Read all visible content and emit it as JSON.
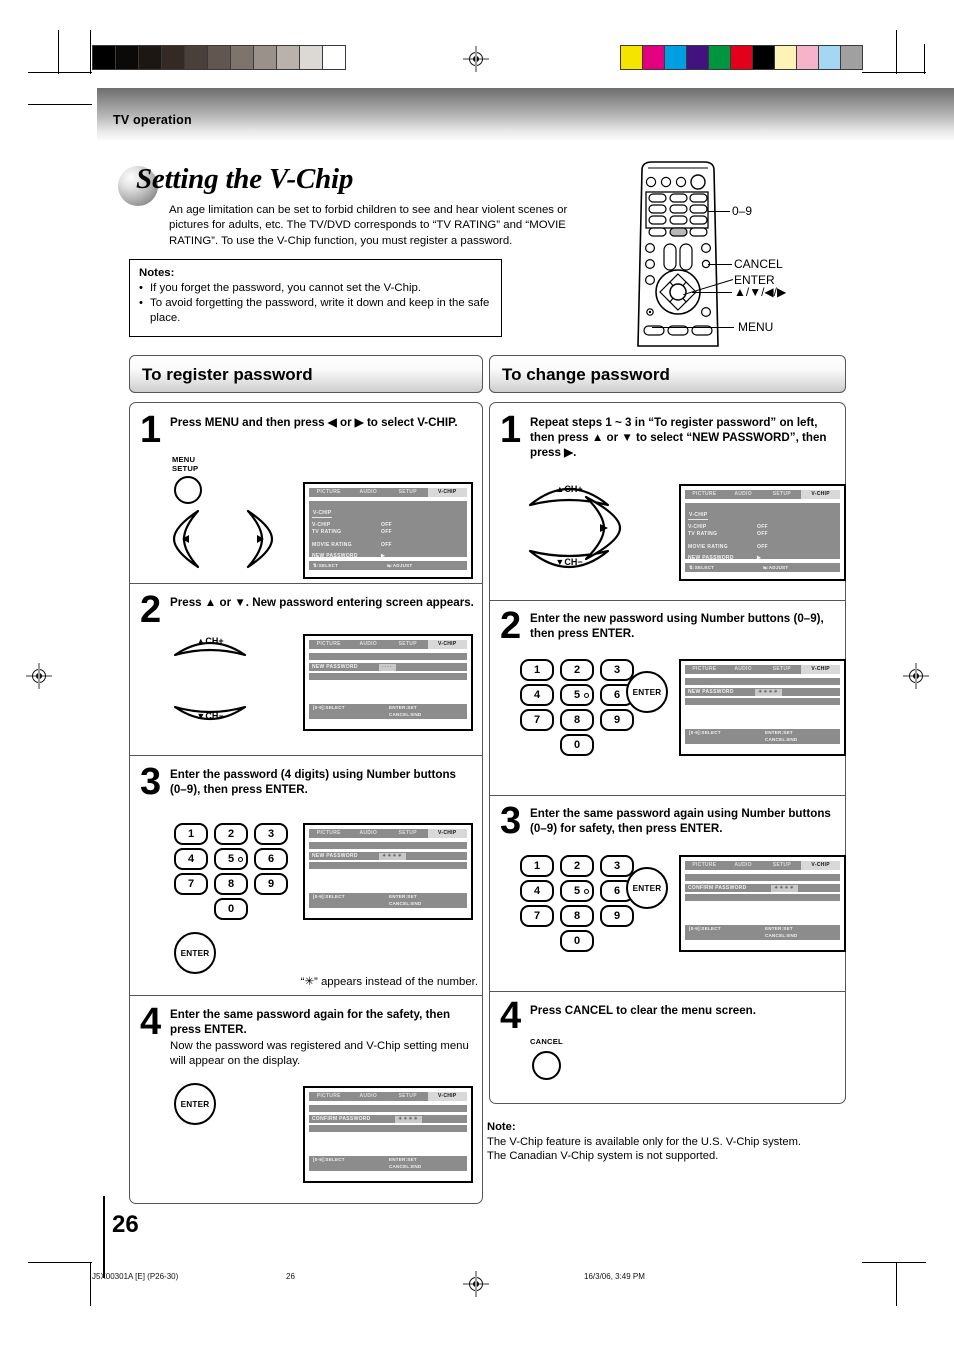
{
  "header": {
    "section": "TV operation"
  },
  "title": {
    "text": "Setting the V-Chip"
  },
  "intro": "An age limitation can be set to forbid children to see and hear violent scenes or pictures for adults, etc. The TV/DVD corresponds to “TV RATING” and “MOVIE RATING”. To use the V-Chip function, you must register a password.",
  "notes_box": {
    "heading": "Notes:",
    "items": [
      "If you forget the password, you cannot set the V-Chip.",
      "To avoid forgetting the password, write it down and keep in the safe place."
    ]
  },
  "remote_callouts": {
    "numbers": "0–9",
    "cancel": "CANCEL",
    "enter": "ENTER",
    "cursor": "▲/▼/◀/▶",
    "menu": "MENU"
  },
  "left_section": {
    "banner": "To register password",
    "steps": [
      {
        "num": "1",
        "text": "Press MENU and then press ◀ or ▶ to select V-CHIP.",
        "button_label": "MENU\nSETUP",
        "button_line1": "MENU",
        "button_line2": "SETUP"
      },
      {
        "num": "2",
        "text": "Press ▲ or ▼. New password entering screen appears.",
        "ch_up": "▲CH+",
        "ch_down": "▼CH−"
      },
      {
        "num": "3",
        "text": "Enter the password (4 digits) using Number buttons (0–9), then press ENTER.",
        "caption": "“✳” appears instead of the number.",
        "enter_label": "ENTER"
      },
      {
        "num": "4",
        "text_bold": "Enter the same password again for the safety, then press ENTER.",
        "text_plain": "Now the password was registered and V-Chip setting menu will appear on the display.",
        "enter_label": "ENTER"
      }
    ]
  },
  "right_section": {
    "banner": "To change password",
    "steps": [
      {
        "num": "1",
        "text": "Repeat steps 1 ~ 3 in “To register password” on left, then press ▲ or ▼ to select “NEW PASSWORD”, then press ▶.",
        "ch_up": "▲CH+",
        "ch_down": "▼CH−"
      },
      {
        "num": "2",
        "text": "Enter the new password using Number buttons (0–9), then press ENTER.",
        "enter_label": "ENTER"
      },
      {
        "num": "3",
        "text": "Enter the same password again using Number buttons (0–9) for safety, then press ENTER.",
        "enter_label": "ENTER"
      },
      {
        "num": "4",
        "text": "Press CANCEL to clear the menu screen.",
        "cancel_label": "CANCEL"
      }
    ],
    "note": {
      "heading": "Note:",
      "line1": "The V-Chip feature is available only for the U.S. V-Chip system.",
      "line2": "The Canadian V-Chip system is not supported."
    }
  },
  "keypad": {
    "keys": [
      "1",
      "2",
      "3",
      "4",
      "5",
      "6",
      "7",
      "8",
      "9",
      "0"
    ]
  },
  "osd": {
    "tabs": [
      "PICTURE",
      "AUDIO",
      "SETUP",
      "V-CHIP"
    ],
    "selected_tab": "V-CHIP",
    "menu_title": "V-CHIP",
    "rows": [
      {
        "label": "V-CHIP",
        "value": "OFF"
      },
      {
        "label": "TV RATING",
        "value": "OFF"
      },
      {
        "label": "MOVIE RATING",
        "value": "OFF"
      },
      {
        "label": "NEW PASSWORD",
        "value": "▶"
      }
    ],
    "footer_select": "⇅:SELECT",
    "footer_adjust": "⇆:ADJUST",
    "pw_footer_select": "[0-9]:SELECT",
    "pw_footer_set": "ENTER:SET",
    "pw_footer_end": "CANCEL:END",
    "new_password_label": "NEW PASSWORD",
    "confirm_password_label": "CONFIRM PASSWORD",
    "pw_empty": "····",
    "pw_filled": "✳✳✳✳"
  },
  "page": {
    "number": "26",
    "footer_left": "J5X00301A [E] (P26-30)",
    "footer_center": "26",
    "footer_right": "16/3/06, 3:49 PM"
  },
  "colors": {
    "gray_ramp": [
      "#000000",
      "#0c0a09",
      "#1d1713",
      "#332a24",
      "#4a4039",
      "#615750",
      "#7d746c",
      "#9a928a",
      "#b9b2ab",
      "#dcd8d3",
      "#ffffff"
    ],
    "color_bars": [
      "#f5e400",
      "#e2007f",
      "#009fe3",
      "#42127e",
      "#009640",
      "#e2001a",
      "#000000",
      "#fcf3b5",
      "#f7b3c9",
      "#a5d7f5",
      "#a0a0a0"
    ]
  }
}
